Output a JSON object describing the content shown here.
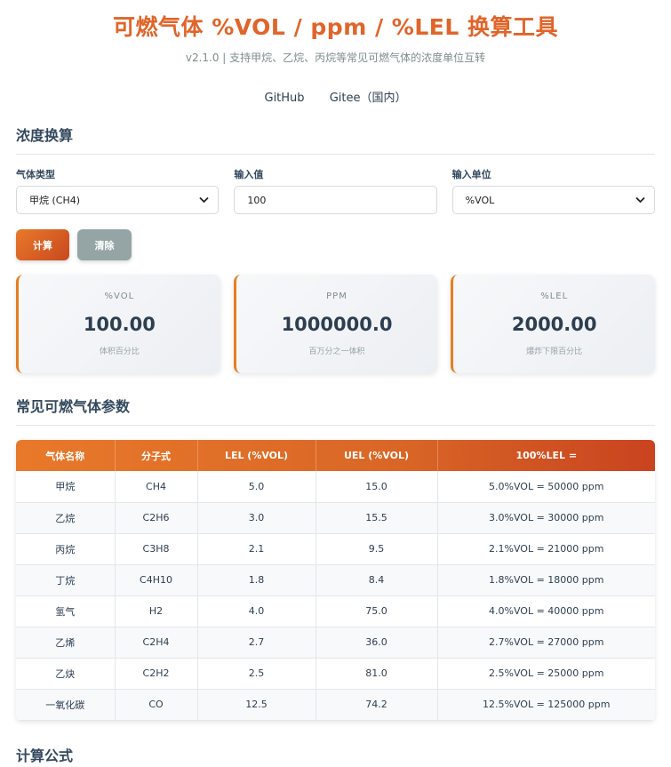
{
  "header": {
    "title": "可燃气体 %VOL / ppm / %LEL 换算工具",
    "subtitle": "v2.1.0 | 支持甲烷、乙烷、丙烷等常见可燃气体的浓度单位互转",
    "links": [
      "GitHub",
      "Gitee（国内）"
    ]
  },
  "converter": {
    "section_title": "浓度换算",
    "gas_label": "气体类型",
    "gas_value": "甲烷 (CH4)",
    "input_label": "输入值",
    "input_value": "100",
    "unit_label": "输入单位",
    "unit_value": "%VOL",
    "calc_button": "计算",
    "clear_button": "清除",
    "results": [
      {
        "label": "%VOL",
        "value": "100.00",
        "desc": "体积百分比"
      },
      {
        "label": "PPM",
        "value": "1000000.0",
        "desc": "百万分之一体积"
      },
      {
        "label": "%LEL",
        "value": "2000.00",
        "desc": "爆炸下限百分比"
      }
    ]
  },
  "gas_table": {
    "section_title": "常见可燃气体参数",
    "headers": [
      "气体名称",
      "分子式",
      "LEL (%VOL)",
      "UEL (%VOL)",
      "100%LEL ="
    ],
    "rows": [
      [
        "甲烷",
        "CH4",
        "5.0",
        "15.0",
        "5.0%VOL = 50000 ppm"
      ],
      [
        "乙烷",
        "C2H6",
        "3.0",
        "15.5",
        "3.0%VOL = 30000 ppm"
      ],
      [
        "丙烷",
        "C3H8",
        "2.1",
        "9.5",
        "2.1%VOL = 21000 ppm"
      ],
      [
        "丁烷",
        "C4H10",
        "1.8",
        "8.4",
        "1.8%VOL = 18000 ppm"
      ],
      [
        "氢气",
        "H2",
        "4.0",
        "75.0",
        "4.0%VOL = 40000 ppm"
      ],
      [
        "乙烯",
        "C2H4",
        "2.7",
        "36.0",
        "2.7%VOL = 27000 ppm"
      ],
      [
        "乙炔",
        "C2H2",
        "2.5",
        "81.0",
        "2.5%VOL = 25000 ppm"
      ],
      [
        "一氧化碳",
        "CO",
        "12.5",
        "74.2",
        "12.5%VOL = 125000 ppm"
      ]
    ]
  },
  "formula": {
    "section_title": "计算公式"
  },
  "colors": {
    "accent": "#e0652a",
    "header_gradient_start": "#e8792a",
    "header_gradient_end": "#c9431f",
    "clear_button": "#95a5a6"
  }
}
